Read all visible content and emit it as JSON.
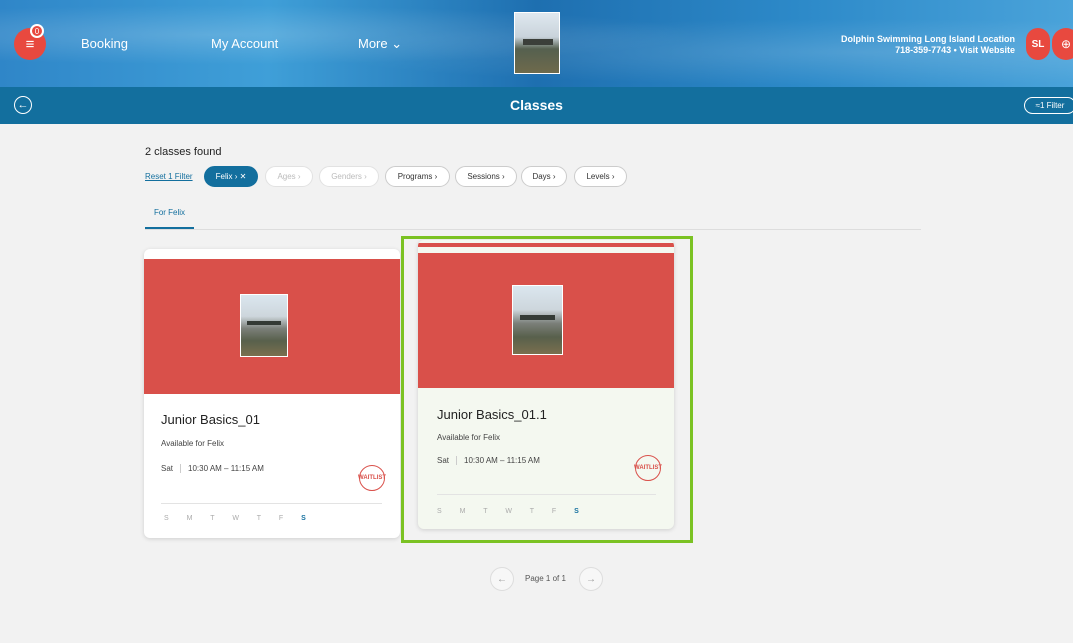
{
  "header": {
    "menu_icon": "≡",
    "badge": "0",
    "nav": [
      "Booking",
      "My Account",
      "More ⌄"
    ],
    "location_name": "Dolphin Swimming Long Island Location",
    "location_info": "718-359-7743 • Visit Website",
    "avatar_initials": "SL",
    "cart_icon": "⊕"
  },
  "subheader": {
    "title": "Classes",
    "back_icon": "←",
    "filter_label": "≈1 Filter"
  },
  "results": {
    "count_text": "2 classes found",
    "reset_text": "Reset 1 Filter"
  },
  "filters": [
    {
      "label": "Felix  ›  ✕"
    },
    {
      "label": "Ages  ›"
    },
    {
      "label": "Genders  ›"
    },
    {
      "label": "Programs  ›"
    },
    {
      "label": "Sessions  ›"
    },
    {
      "label": "Days  ›"
    },
    {
      "label": "Levels  ›"
    }
  ],
  "tabs": [
    "For Felix"
  ],
  "cards": [
    {
      "title": "Junior Basics_01",
      "availability": "Available for Felix",
      "day": "Sat",
      "time": "10:30 AM – 11:15 AM",
      "status": "WAITLIST",
      "days_prefix": "S M T W T F",
      "days_active": "S"
    },
    {
      "title": "Junior Basics_01.1",
      "availability": "Available for Felix",
      "day": "Sat",
      "time": "10:30 AM – 11:15 AM",
      "status": "WAITLIST",
      "days_prefix": "S M T W T F",
      "days_active": "S"
    }
  ],
  "pagination": {
    "prev_icon": "←",
    "label": "Page 1 of 1",
    "next_icon": "→"
  },
  "colors": {
    "primary": "#136f9e",
    "accent": "#d9504a",
    "highlight": "#7bc223"
  }
}
